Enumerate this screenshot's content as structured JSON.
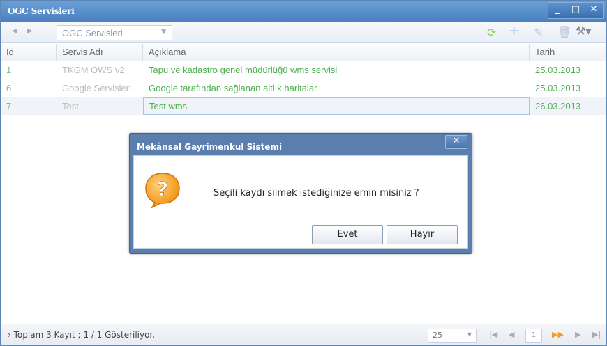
{
  "window": {
    "title": "OGC Servisleri",
    "controls": [
      "_",
      "□",
      "✕"
    ]
  },
  "toolbar": {
    "combo_value": "OGC Servisleri",
    "tools": [
      "refresh-icon",
      "add-icon",
      "edit-icon",
      "delete-icon",
      "settings-icon"
    ]
  },
  "grid": {
    "columns": [
      "Id",
      "Servis Adı",
      "Açıklama",
      "Tarih"
    ],
    "rows": [
      {
        "id": "1",
        "name": "TKGM OWS v2",
        "desc": "Tapu ve kadastro genel müdürlüğü wms servisi",
        "date": "25.03.2013"
      },
      {
        "id": "6",
        "name": "Google Servisleri",
        "desc": "Google tarafından sağlanan altlık haritalar",
        "date": "25.03.2013"
      },
      {
        "id": "7",
        "name": "Test",
        "desc": "Test wms",
        "date": "26.03.2013"
      }
    ]
  },
  "status": {
    "text": "Toplam 3 Kayıt ; 1 / 1 Gösteriliyor.",
    "page_size": "25",
    "page": "1"
  },
  "dialog": {
    "title": "Mekânsal Gayrimenkul Sistemi",
    "close": "✕",
    "message": "Seçili kaydı silmek istediğinize emin misiniz ?",
    "yes_label": "Evet",
    "no_label": "Hayır"
  },
  "colors": {
    "title_bar": "#4a80c0",
    "row_text": "#4caf50",
    "icon_orange": "#f39a1e"
  }
}
